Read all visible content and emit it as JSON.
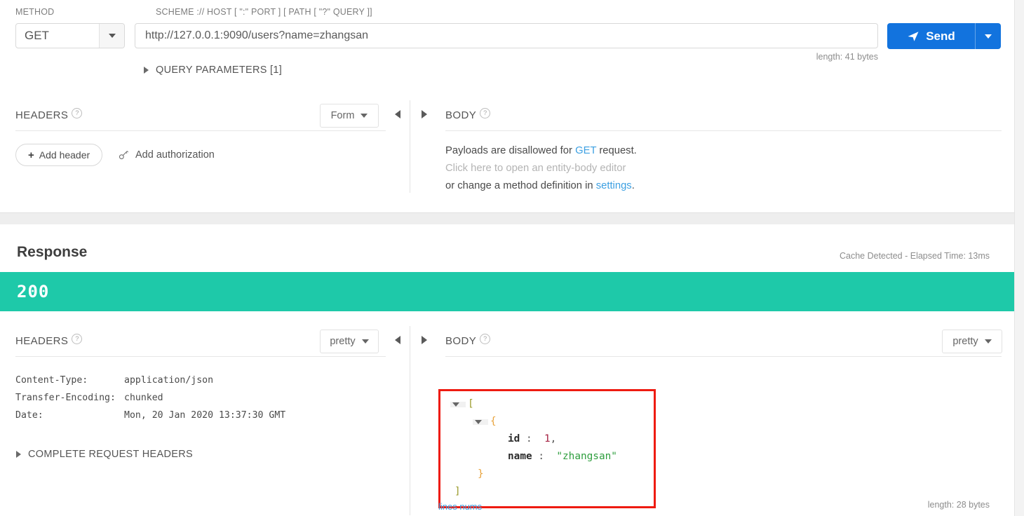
{
  "request": {
    "method_label": "METHOD",
    "url_label": "SCHEME :// HOST [ \":\" PORT ] [ PATH [ \"?\" QUERY ]]",
    "method_value": "GET",
    "url_value": "http://127.0.0.1:9090/users?name=zhangsan",
    "url_placeholder": "http://",
    "send_label": "Send",
    "length_label": "length: 41 bytes",
    "query_parameters_label": "QUERY PARAMETERS [1]",
    "headers": {
      "title": "HEADERS",
      "help": "?",
      "format_select": "Form",
      "add_header_label": "Add header",
      "add_header_plus": "+",
      "add_authorization_label": "Add authorization"
    },
    "body": {
      "title": "BODY",
      "help": "?",
      "line1_pre": "Payloads are disallowed for ",
      "line1_link": "GET",
      "line1_post": " request.",
      "line2": "Click here to open an entity-body editor",
      "line3_pre": "or change a method definition in ",
      "line3_link": "settings",
      "line3_post": "."
    }
  },
  "response": {
    "title": "Response",
    "meta": "Cache Detected - Elapsed Time: 13ms",
    "status_code": "200",
    "status_color": "#1ec9a9",
    "headers": {
      "title": "HEADERS",
      "help": "?",
      "format_select": "pretty",
      "rows": [
        {
          "key": "Content-Type:",
          "value": "application/json"
        },
        {
          "key": "Transfer-Encoding:",
          "value": "chunked"
        },
        {
          "key": "Date:",
          "value": "Mon, 20 Jan 2020 13:37:30 GMT"
        }
      ],
      "complete_request_headers_label": "COMPLETE REQUEST HEADERS"
    },
    "body": {
      "title": "BODY",
      "help": "?",
      "format_select": "pretty",
      "json": {
        "open_array": "[",
        "open_object": "{",
        "key_id": "id",
        "colon": ":",
        "value_id": "1",
        "comma": ",",
        "key_name": "name",
        "value_name": "\"zhangsan\"",
        "close_object": "}",
        "close_array": "]"
      },
      "lines_nums_label": "lines nums",
      "length_label": "length: 28 bytes",
      "highlight_color": "#ee1b11"
    }
  }
}
